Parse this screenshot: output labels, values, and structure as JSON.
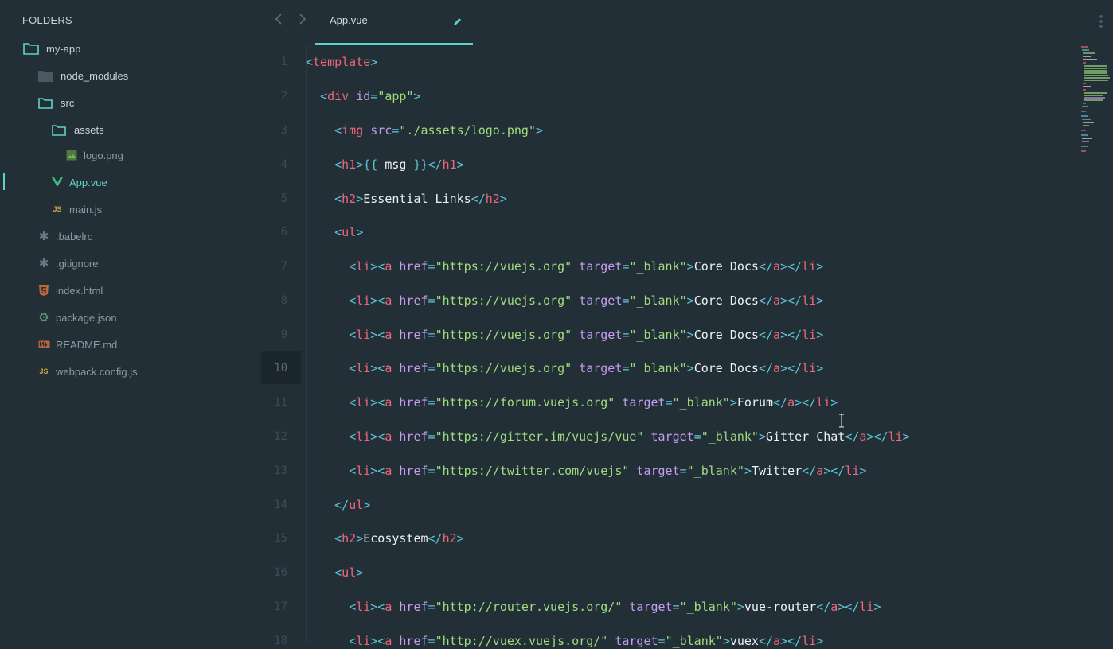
{
  "sidebar": {
    "title": "FOLDERS",
    "items": [
      {
        "label": "my-app",
        "icon": "folder-open-icon"
      },
      {
        "label": "node_modules",
        "icon": "folder-closed-icon"
      },
      {
        "label": "src",
        "icon": "folder-open-icon"
      },
      {
        "label": "assets",
        "icon": "folder-open-icon"
      },
      {
        "label": "logo.png",
        "icon": "image-file-icon"
      },
      {
        "label": "App.vue",
        "icon": "vue-file-icon"
      },
      {
        "label": "main.js",
        "icon": "js-file-icon",
        "icon_text": "JS"
      },
      {
        "label": ".babelrc",
        "icon": "asterisk-file-icon"
      },
      {
        "label": ".gitignore",
        "icon": "asterisk-file-icon"
      },
      {
        "label": "index.html",
        "icon": "html5-file-icon"
      },
      {
        "label": "package.json",
        "icon": "npm-gear-icon"
      },
      {
        "label": "README.md",
        "icon": "markdown-file-icon"
      },
      {
        "label": "webpack.config.js",
        "icon": "js-file-icon",
        "icon_text": "JS"
      }
    ]
  },
  "tabs": [
    {
      "label": "App.vue",
      "active": true
    }
  ],
  "editor": {
    "current_line": 10,
    "line_numbers": [
      "1",
      "2",
      "3",
      "4",
      "5",
      "6",
      "7",
      "8",
      "9",
      "10",
      "11",
      "12",
      "13",
      "14",
      "15",
      "16",
      "17",
      "18"
    ]
  },
  "colors": {
    "background": "#232f37",
    "accent": "#5fd3c8",
    "tag": "#f0677a",
    "punctuation": "#5ec4d7",
    "attribute": "#c59cf2",
    "string": "#9fdc7e"
  }
}
